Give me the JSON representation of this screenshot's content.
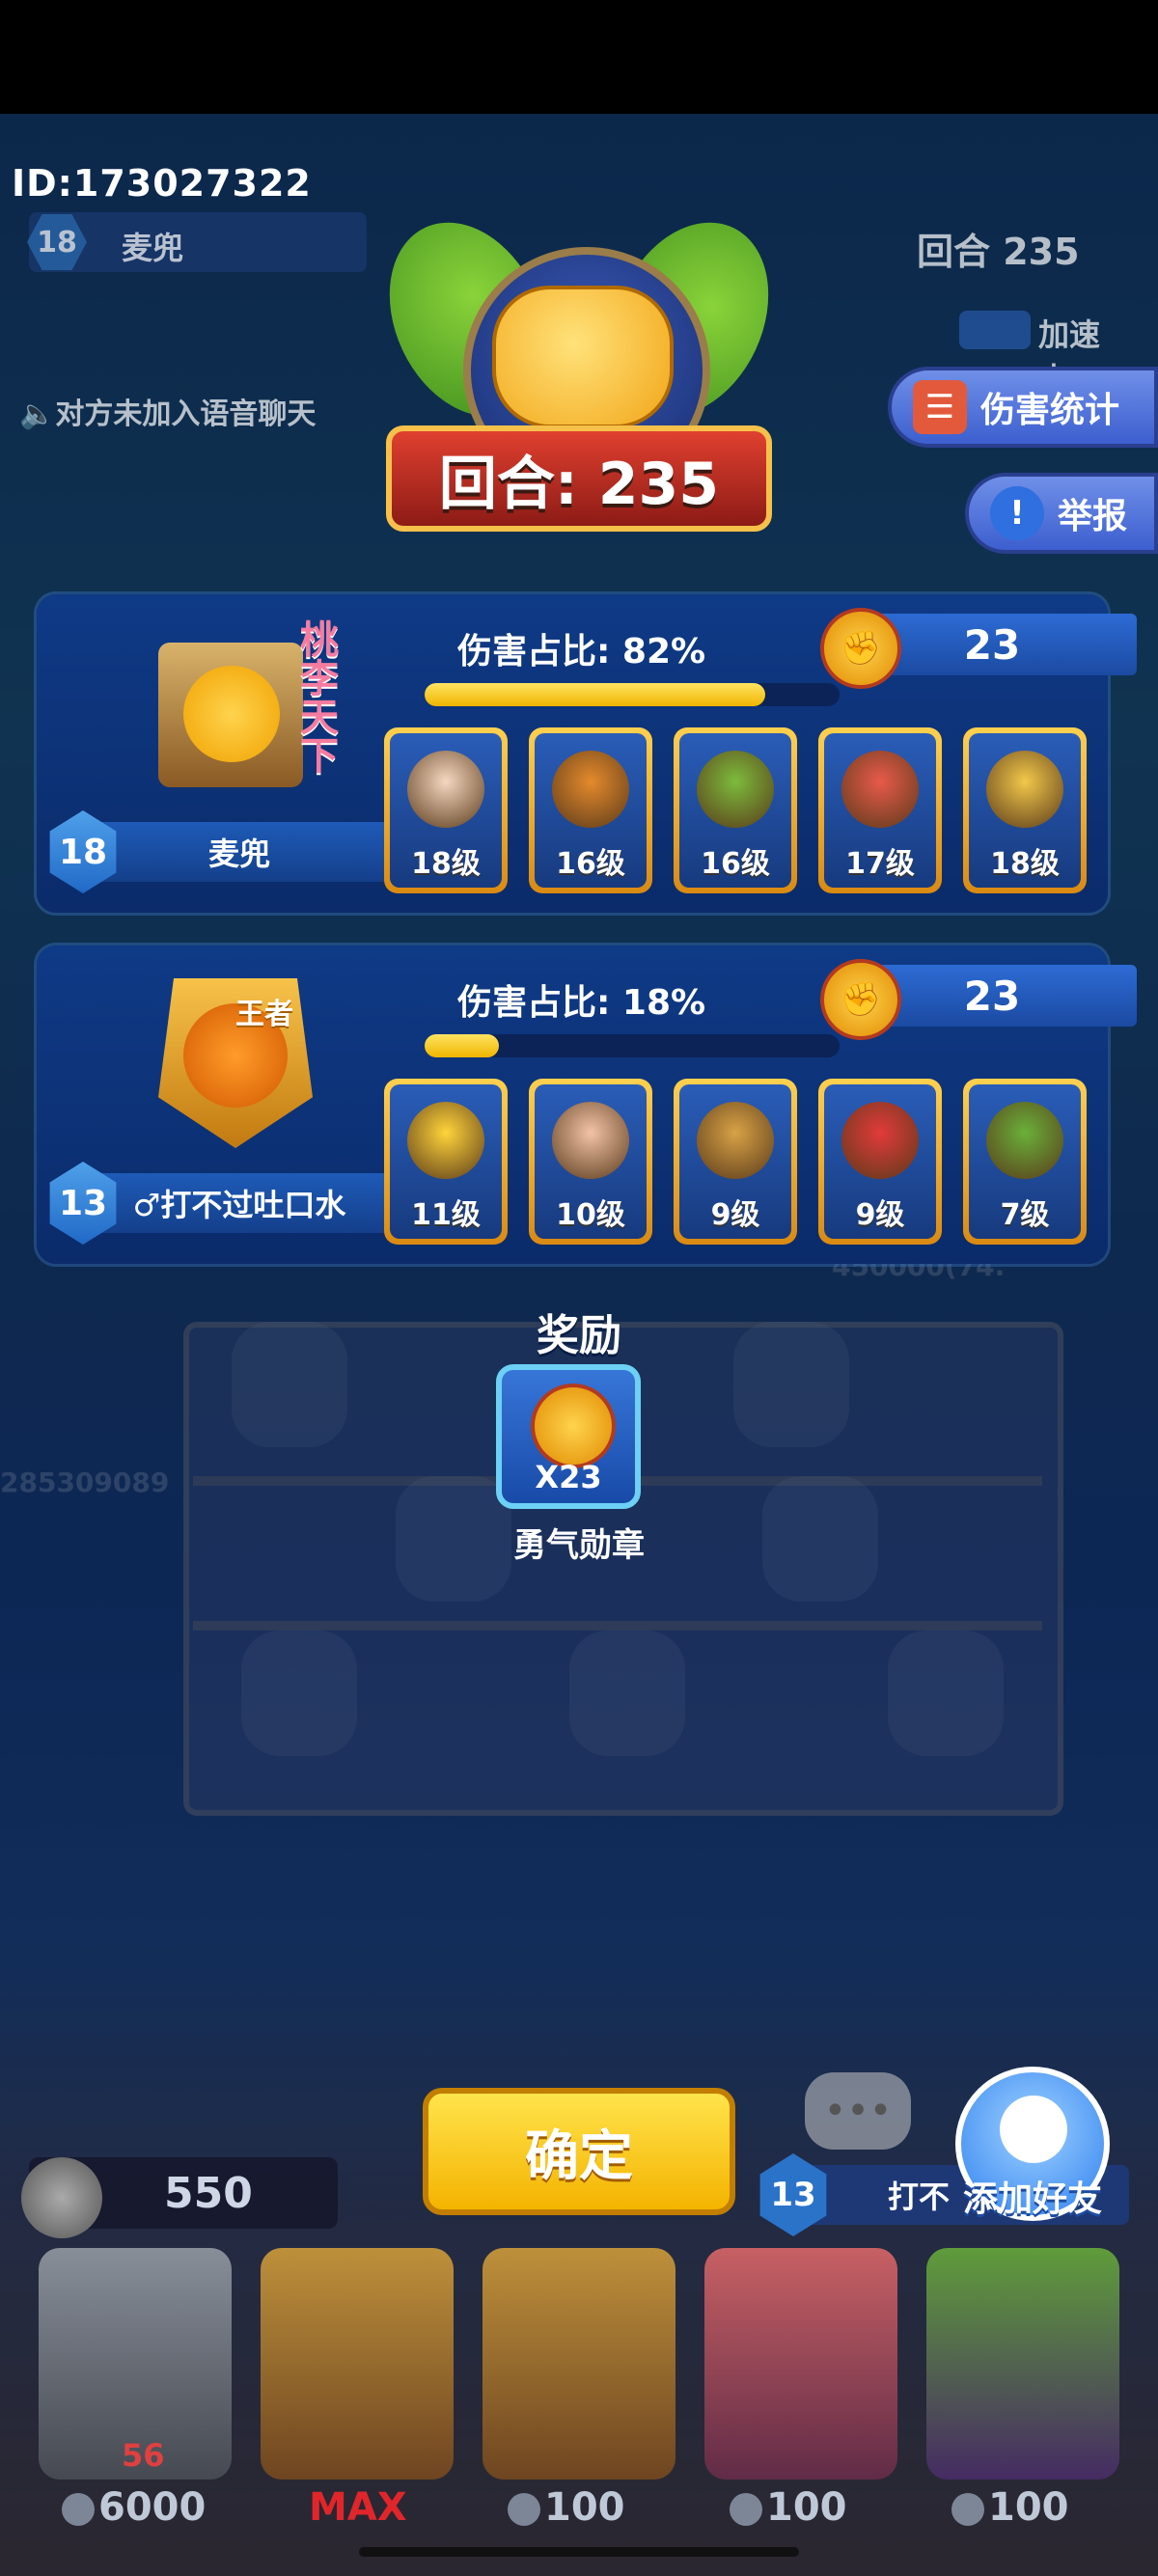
{
  "header": {
    "player_id": "ID:173027322",
    "opponent_level": "18",
    "opponent_name": "麦兜",
    "round_small": "回合 235",
    "voice_notice": "对方未加入语音聊天",
    "speed_label": "加速中..."
  },
  "side_buttons": {
    "damage_stats": "伤害统计",
    "report": "举报"
  },
  "result": {
    "round_banner": "回合: 235"
  },
  "players": [
    {
      "level": "18",
      "name": "麦兜",
      "avatar_text": "桃李天下",
      "damage_label": "伤害占比: 82%",
      "damage_fraction": 0.82,
      "medals": "23",
      "heroes": [
        {
          "level": "18级",
          "color": "#f5d7c0"
        },
        {
          "level": "16级",
          "color": "#e58a2c"
        },
        {
          "level": "16级",
          "color": "#7dbb3c"
        },
        {
          "level": "17级",
          "color": "#e85a4a"
        },
        {
          "level": "18级",
          "color": "#f2c84a"
        }
      ]
    },
    {
      "level": "13",
      "name": "♂打不过吐口水",
      "avatar_text": "王者",
      "damage_label": "伤害占比: 18%",
      "damage_fraction": 0.18,
      "medals": "23",
      "heroes": [
        {
          "level": "11级",
          "color": "#ffd43a"
        },
        {
          "level": "10级",
          "color": "#f3c3a8"
        },
        {
          "level": "9级",
          "color": "#d8a246"
        },
        {
          "level": "9级",
          "color": "#e23a3a"
        },
        {
          "level": "7级",
          "color": "#6ab03a"
        }
      ]
    }
  ],
  "reward": {
    "title": "奖励",
    "count": "X23",
    "name": "勇气勋章"
  },
  "background_text": {
    "score_a": "450000(74.",
    "score_b": "285309089"
  },
  "bottom": {
    "confirm_label": "确定",
    "coins": "550",
    "chat_icon": "chat-icon",
    "opponent_level": "13",
    "opponent_name_short": "打不",
    "add_friend": "添加好友",
    "card_level": "56",
    "prices": [
      "6000",
      "MAX",
      "100",
      "100",
      "100"
    ]
  },
  "colors": {
    "accent_gold": "#f4b300",
    "panel_blue": "#0f3a86",
    "damage_bar": "#ffd43a"
  }
}
